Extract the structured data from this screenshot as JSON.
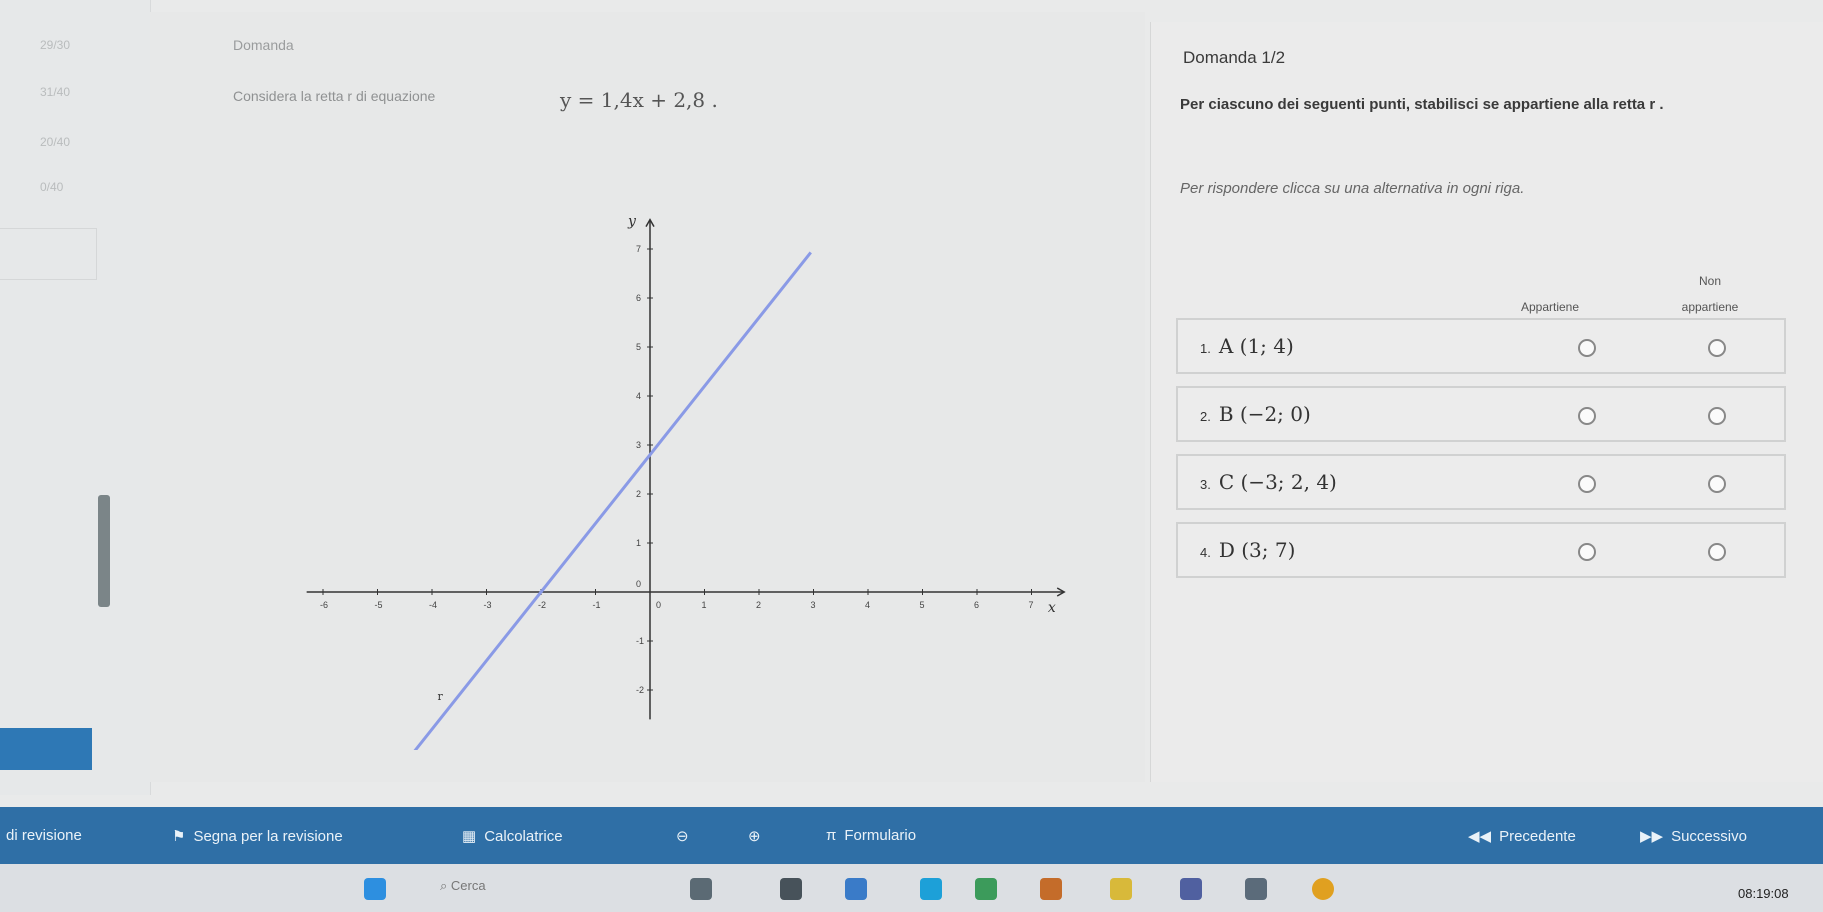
{
  "sidebar": {
    "items": [
      "29/30",
      "31/40",
      "20/40",
      "0/40"
    ]
  },
  "question": {
    "header": "Domanda",
    "text": "Considera la retta r di equazione",
    "equation": "y = 1,4x + 2,8 ."
  },
  "graph": {
    "x_label": "x",
    "y_label": "y",
    "x_ticks": [
      "-6",
      "-5",
      "-4",
      "-3",
      "-2",
      "-1",
      "0",
      "1",
      "2",
      "3",
      "4",
      "5",
      "6",
      "7"
    ],
    "y_ticks": [
      "7",
      "6",
      "5",
      "4",
      "3",
      "2",
      "1",
      "0",
      "-1",
      "-2"
    ],
    "line_label": "r",
    "line": {
      "slope": 1.4,
      "intercept": 2.8
    },
    "colors": {
      "line": "#8a9ae6",
      "axis": "#333333"
    }
  },
  "right": {
    "title": "Domanda 1/2",
    "instruction": "Per ciascuno dei seguenti punti, stabilisci se appartiene alla retta r .",
    "hint": "Per rispondere clicca su una alternativa in ogni riga.",
    "col1": "Appartiene",
    "col2_line1": "Non",
    "col2_line2": "appartiene",
    "rows": [
      {
        "num": "1.",
        "label": "A (1; 4)"
      },
      {
        "num": "2.",
        "label": "B (−2; 0)"
      },
      {
        "num": "3.",
        "label": "C (−3; 2, 4)"
      },
      {
        "num": "4.",
        "label": "D (3; 7)"
      }
    ]
  },
  "toolbar": {
    "review": "di revisione",
    "mark": "Segna per la revisione",
    "calculator": "Calcolatrice",
    "formulas": "Formulario",
    "prev": "Precedente",
    "next": "Successivo"
  },
  "taskbar": {
    "search_placeholder": "Cerca",
    "clock": "08:19:08"
  }
}
